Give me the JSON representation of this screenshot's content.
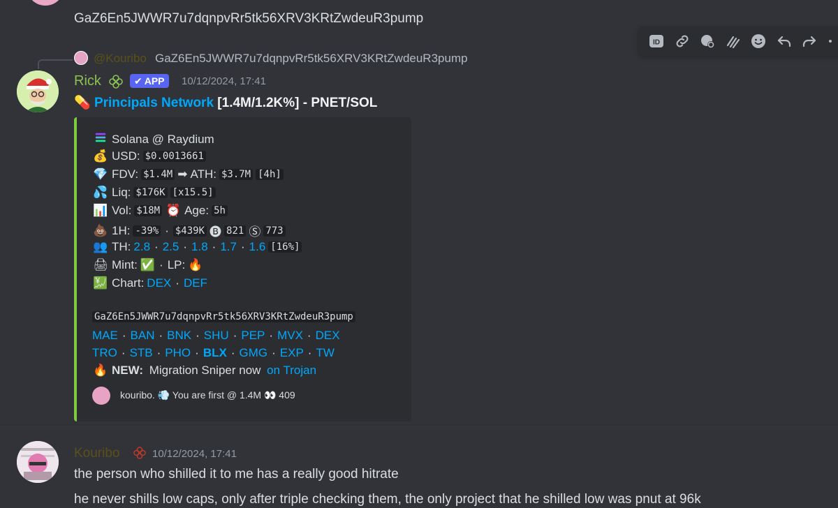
{
  "top_message": {
    "text": "GaZ6En5JWWR7u7dqnpvRr5tk56XRV3KRtZwdeuR3pump"
  },
  "toolbar": {
    "icons": [
      "id-icon",
      "link-icon",
      "thread-icon",
      "forward-stack-icon",
      "emoji-icon",
      "reply-icon",
      "forward-icon",
      "more-icon"
    ],
    "id_label": "ID"
  },
  "reply": {
    "author": "@Kouribo",
    "text": "GaZ6En5JWWR7u7dqnpvRr5tk56XRV3KRtZwdeuR3pump"
  },
  "rick": {
    "name": "Rick",
    "tag": "APP",
    "timestamp": "10/12/2024, 17:41",
    "title_link": "Principals Network",
    "title_rest": " [1.4M/1.2K%] - PNET/SOL"
  },
  "embed": {
    "chain": "Solana @ Raydium",
    "usd_label": "USD:",
    "usd_value": "$0.0013661",
    "fdv_label": "FDV:",
    "fdv_value": "$1.4M",
    "ath_label": "ATH:",
    "ath_value": "$3.7M",
    "ath_time": "[4h]",
    "liq_label": "Liq:",
    "liq_value": "$176K",
    "liq_mult": "[x15.5]",
    "vol_label": "Vol:",
    "vol_value": "$18M",
    "age_label": "Age:",
    "age_value": "5h",
    "h1_label": "1H:",
    "h1_change": "-39%",
    "h1_volume": "$439K",
    "buys": "821",
    "sells": "773",
    "th_label": "TH:",
    "th_values": [
      "2.8",
      "2.5",
      "1.8",
      "1.7",
      "1.6"
    ],
    "th_total": "[16%]",
    "mint_label": "Mint:",
    "lp_label": "LP:",
    "chart_label": "Chart:",
    "chart_links": [
      "DEX",
      "DEF"
    ],
    "contract": "GaZ6En5JWWR7u7dqnpvRr5tk56XRV3KRtZwdeuR3pump",
    "links_row1": [
      "MAE",
      "BAN",
      "BNK",
      "SHU",
      "PEP",
      "MVX",
      "DEX"
    ],
    "links_row2": [
      "TRO",
      "STB",
      "PHO",
      "BLX",
      "GMG",
      "EXP",
      "TW"
    ],
    "new_label": "NEW:",
    "new_text": " Migration Sniper now ",
    "new_link": "on Trojan",
    "footer_user": "kouribo.",
    "footer_text": " You are first @ 1.4M ",
    "footer_count": " 409"
  },
  "kouribo": {
    "name": "Kouribo",
    "timestamp": "10/12/2024, 17:41",
    "line1": "the person who shilled it to me has a really good hitrate",
    "line2": "he never shills low caps, only after triple checking them, the only project that he shilled low was pnut at 96k"
  }
}
